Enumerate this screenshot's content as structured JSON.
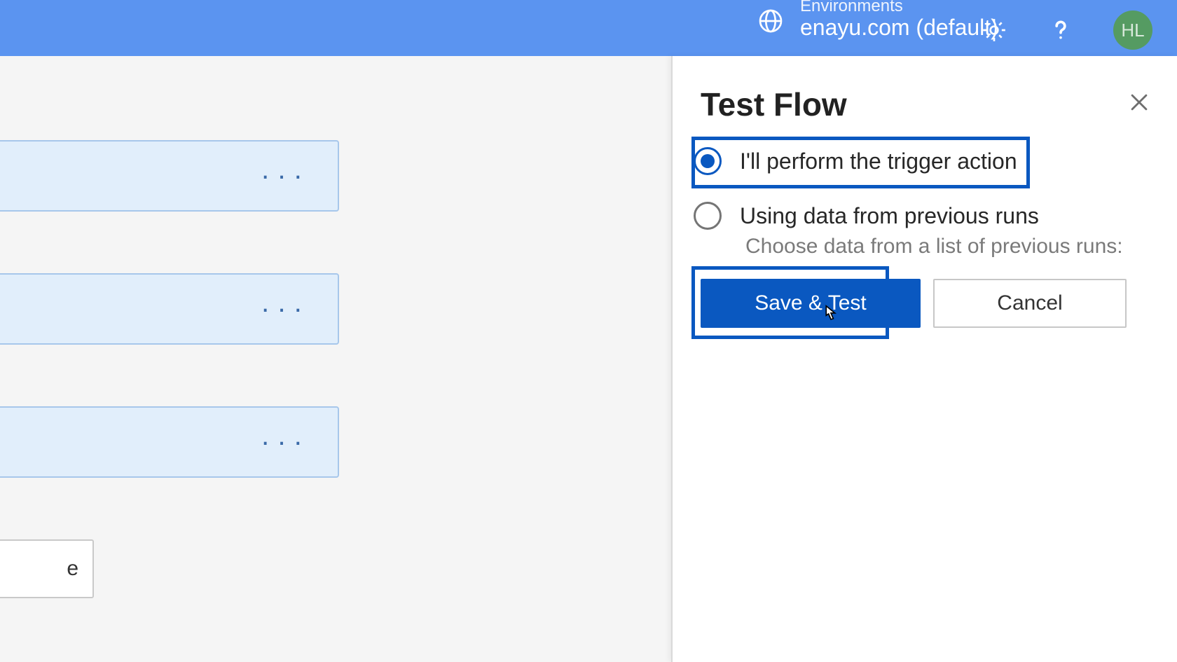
{
  "header": {
    "env_label": "Environments",
    "env_name": "enayu.com (default)",
    "avatar_initials": "HL"
  },
  "canvas": {
    "new_step_label": "e"
  },
  "panel": {
    "title": "Test Flow",
    "option_manual": "I'll perform the trigger action",
    "option_previous": "Using data from previous runs",
    "option_previous_sub": "Choose data from a list of previous runs:",
    "save_test_label": "Save & Test",
    "cancel_label": "Cancel"
  }
}
